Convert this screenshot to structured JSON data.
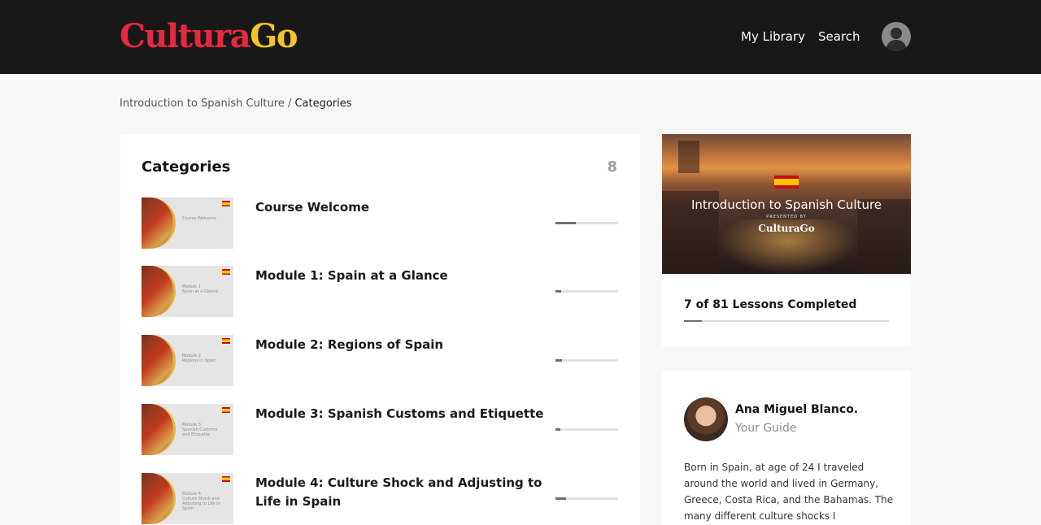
{
  "header": {
    "logo_part1": "Cultura",
    "logo_part2": "Go",
    "nav": [
      "My Library",
      "Search"
    ],
    "accent_red": "#e8283f",
    "accent_yellow": "#f5c521"
  },
  "breadcrumb": {
    "parent": "Introduction to Spanish Culture",
    "separator": " / ",
    "current": "Categories"
  },
  "categories": {
    "title": "Categories",
    "count": "8",
    "items": [
      {
        "title": "Course Welcome",
        "thumb_text": "Course Welcome",
        "progress": 0.33
      },
      {
        "title": "Module 1: Spain at a Glance",
        "thumb_text": "Module 1\nSpain at a Glance",
        "progress": 0.09
      },
      {
        "title": "Module 2: Regions of Spain",
        "thumb_text": "Module 2\nRegions in Spain",
        "progress": 0.1
      },
      {
        "title": "Module 3: Spanish Customs and Etiquette",
        "thumb_text": "Module 3\nSpanish Customs\nand Etiquette",
        "progress": 0.08
      },
      {
        "title": "Module 4: Culture Shock and Adjusting to Life in Spain",
        "thumb_text": "Module 4\nCulture Shock and Adjusting to Life in\nSpain",
        "progress": 0.17
      }
    ]
  },
  "course": {
    "hero_title": "Introduction to Spanish Culture",
    "hero_subtitle": "PRESENTED BY",
    "hero_brand": "CulturaGo",
    "lessons_text": "7 of 81 Lessons Completed",
    "lessons_completed": 7,
    "lessons_total": 81
  },
  "guide": {
    "name": "Ana Miguel Blanco.",
    "role": "Your Guide",
    "bio": "Born in Spain, at age of 24 I traveled around the world and lived in Germany, Greece, Costa Rica, and the Bahamas. The many different culture shocks I"
  }
}
